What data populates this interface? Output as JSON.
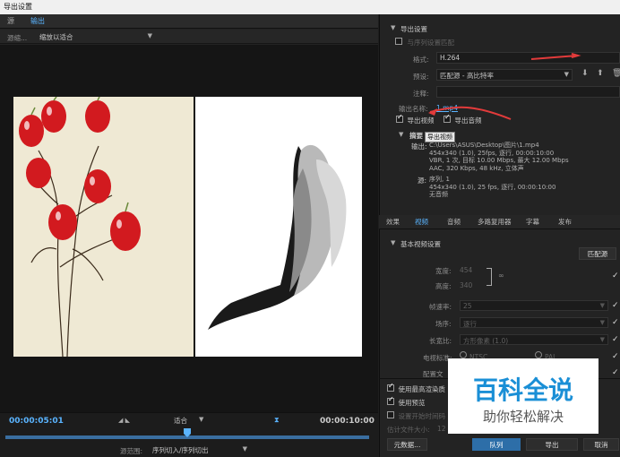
{
  "window": {
    "title": "导出设置"
  },
  "left_tabs": [
    "源",
    "输出"
  ],
  "source": {
    "scaling_label": "源缩...",
    "scaling_value": "缩放以适合"
  },
  "timeline": {
    "current_time": "00:00:05:01",
    "end_time": "00:00:10:00",
    "fit_value": "适合",
    "source_range_label": "源范围:",
    "source_range_value": "序列切入/序列切出",
    "playhead_fraction": 0.5
  },
  "export_settings": {
    "header": "导出设置",
    "match_sequence": "与序列设置匹配",
    "format_label": "格式:",
    "format_value": "H.264",
    "preset_label": "预设:",
    "preset_value": "匹配源 - 高比特率",
    "comments_label": "注释:",
    "output_name_label": "输出名称:",
    "output_name_value": "1.mp4",
    "export_video": "导出视频",
    "export_audio": "导出音频",
    "tooltip": "导出视频",
    "summary_label": "摘要",
    "summary_output_label": "输出:",
    "summary_output_lines": [
      "C:\\Users\\ASUS\\Desktop\\图片\\1.mp4",
      "454x340 (1.0), 25fps, 逐行, 00:00:10:00",
      "VBR, 1 次, 目标 10.00 Mbps, 最大 12.00 Mbps",
      "AAC, 320 Kbps, 48  kHz, 立体声"
    ],
    "summary_source_label": "源:",
    "summary_source_lines": [
      "序列, 1",
      "454x340 (1.0), 25 fps, 逐行, 00:00:10:00",
      "无音频"
    ]
  },
  "right_tabs": [
    "效果",
    "视频",
    "音频",
    "多路复用器",
    "字幕",
    "发布"
  ],
  "video_settings": {
    "header": "基本视频设置",
    "match_source_button": "匹配源",
    "width_label": "宽度:",
    "width_value": "454",
    "height_label": "高度:",
    "height_value": "340",
    "frame_rate_label": "帧速率:",
    "frame_rate_value": "25",
    "field_order_label": "场序:",
    "field_order_value": "逐行",
    "aspect_label": "长宽比:",
    "aspect_value": "方形像素 (1.0)",
    "tv_standard_label": "电视标准:",
    "tv_standard_ntsc": "NTSC",
    "tv_standard_pal": "PAL",
    "profile_label": "配置文"
  },
  "bottom_options": {
    "max_render_quality": "使用最高渲染质",
    "use_previews": "使用预览",
    "set_start_timecode": "设置开始时间码",
    "estimated_size_label": "估计文件大小:",
    "estimated_size_value": "12"
  },
  "buttons": {
    "metadata": "元数据...",
    "queue": "队列",
    "export": "导出",
    "cancel": "取消"
  },
  "watermark": {
    "title": "百科全说",
    "subtitle": "助你轻松解决"
  },
  "colors": {
    "accent": "#5ab4ff",
    "annotation_arrow": "#e23b3b",
    "watermark_blue": "#1a8fd6"
  }
}
